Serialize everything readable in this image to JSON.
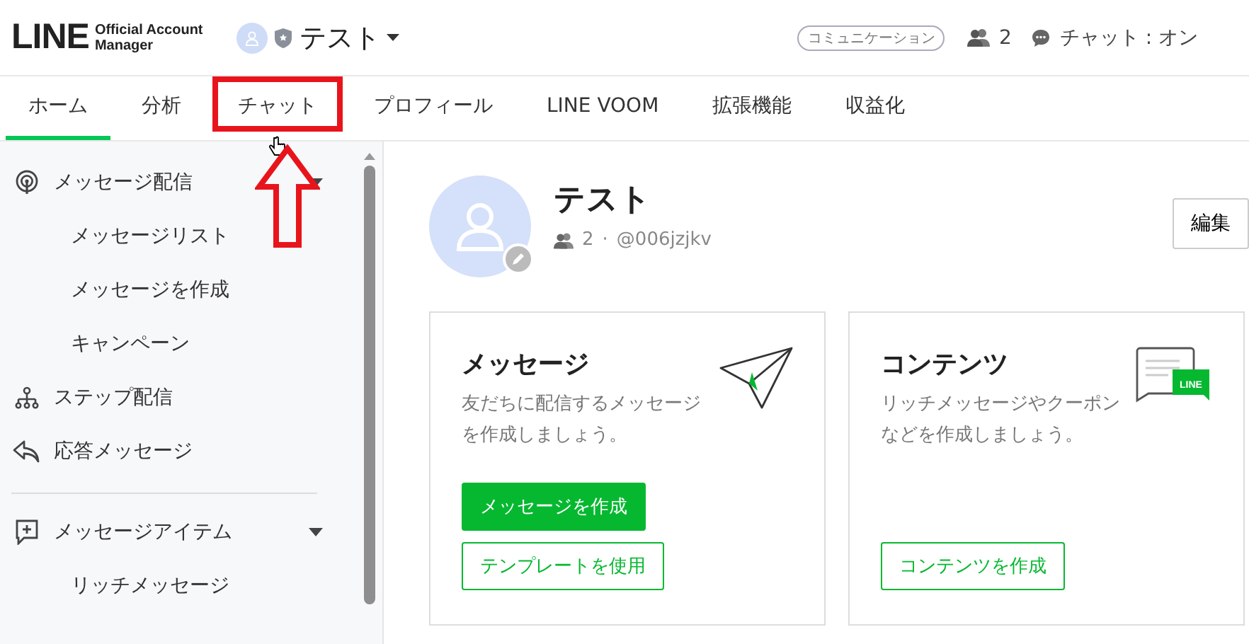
{
  "header": {
    "logo": {
      "wordmark": "LINE",
      "subtitle_1": "Official Account",
      "subtitle_2": "Manager"
    },
    "account_name": "テスト",
    "plan_badge": "コミュニケーション",
    "friends_count": "2",
    "chat_status": "チャット : オン"
  },
  "tabs": [
    {
      "label": "ホーム",
      "selected": true,
      "highlighted": false
    },
    {
      "label": "分析",
      "selected": false,
      "highlighted": false
    },
    {
      "label": "チャット",
      "selected": false,
      "highlighted": true
    },
    {
      "label": "プロフィール",
      "selected": false,
      "highlighted": false
    },
    {
      "label": "LINE VOOM",
      "selected": false,
      "highlighted": false
    },
    {
      "label": "拡張機能",
      "selected": false,
      "highlighted": false
    },
    {
      "label": "収益化",
      "selected": false,
      "highlighted": false
    }
  ],
  "sidebar": {
    "sections": [
      {
        "items": [
          {
            "label": "メッセージ配信",
            "kind": "broadcast",
            "expanded": true,
            "children": [
              {
                "label": "メッセージリスト"
              },
              {
                "label": "メッセージを作成"
              },
              {
                "label": "キャンペーン"
              }
            ]
          },
          {
            "label": "ステップ配信",
            "kind": "step"
          },
          {
            "label": "応答メッセージ",
            "kind": "reply"
          }
        ]
      },
      {
        "items": [
          {
            "label": "メッセージアイテム",
            "kind": "item",
            "expanded": true,
            "children": [
              {
                "label": "リッチメッセージ"
              }
            ]
          }
        ]
      }
    ]
  },
  "profile": {
    "name": "テスト",
    "friends_count": "2",
    "separator": "·",
    "account_id": "@006jzjkv",
    "edit_button": "編集"
  },
  "cards": [
    {
      "kind": "message",
      "title": "メッセージ",
      "description": "友だちに配信するメッセージを作成しましょう。",
      "buttons": [
        {
          "label": "メッセージを作成",
          "primary": true
        },
        {
          "label": "テンプレートを使用",
          "primary": false
        }
      ]
    },
    {
      "kind": "content",
      "icon_label": "LINE",
      "title": "コンテンツ",
      "description": "リッチメッセージやクーポンなどを作成しましょう。",
      "buttons": [
        {
          "label": "コンテンツを作成",
          "primary": false
        }
      ]
    }
  ]
}
